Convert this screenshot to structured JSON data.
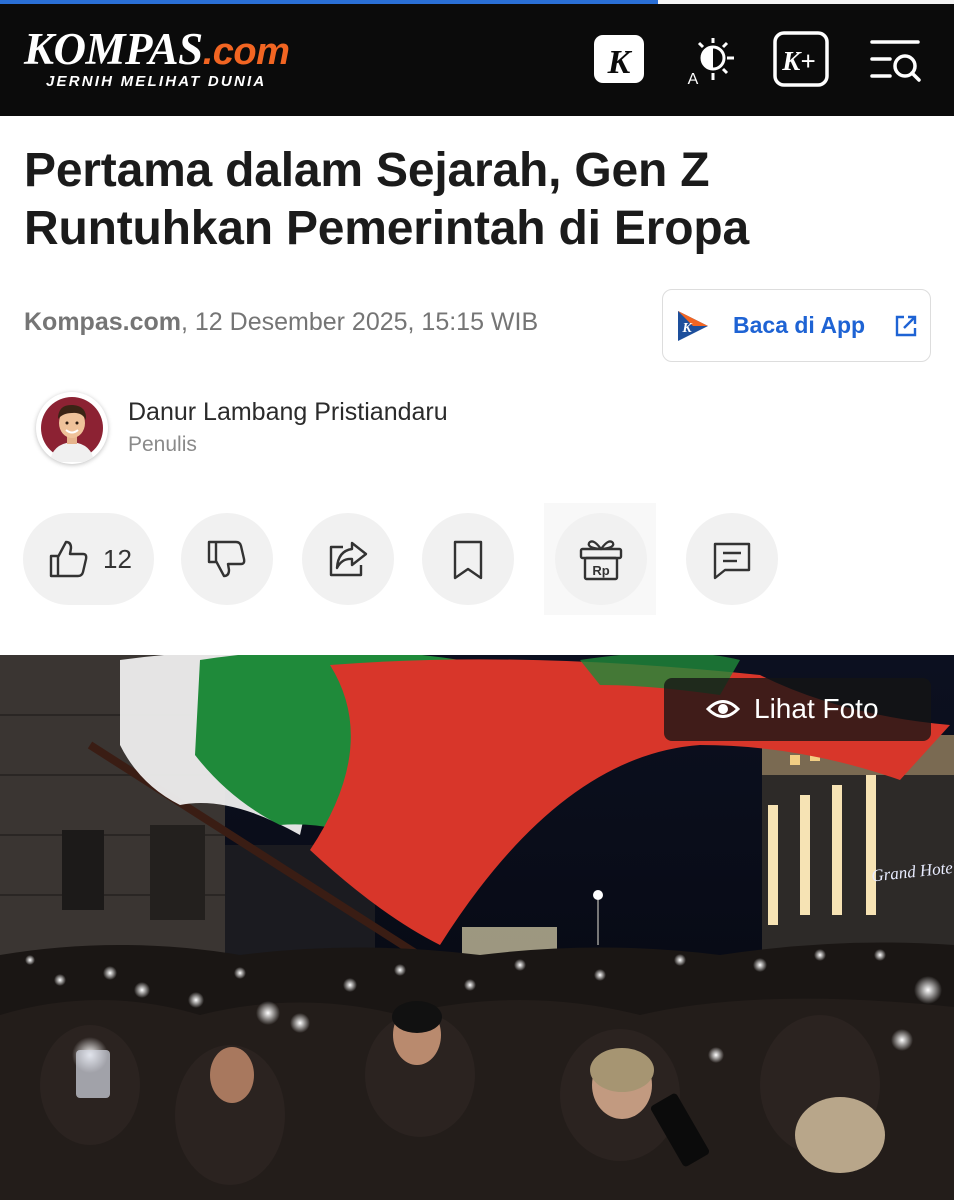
{
  "header": {
    "logo_brand": "KOMPAS",
    "logo_tld": ".com",
    "logo_tagline": "JERNIH MELIHAT DUNIA",
    "reading_progress": 0.69,
    "icons": [
      "kompas-k-icon",
      "display-mode-icon",
      "kompas-plus-icon",
      "menu-search-icon"
    ]
  },
  "article": {
    "title": "Pertama dalam Sejarah, Gen Z Runtuhkan Pemerintah di Eropa",
    "source": "Kompas.com",
    "date_sep": ", ",
    "datetime": "12 Desember 2025, 15:15 WIB",
    "app_button_label": "Baca di App"
  },
  "author": {
    "name": "Danur Lambang Pristiandaru",
    "role": "Penulis"
  },
  "actions": {
    "like_count": "12",
    "items": [
      "like",
      "dislike",
      "share",
      "bookmark",
      "gift",
      "comment"
    ]
  },
  "photo": {
    "view_label": "Lihat Foto",
    "sign_text": "Grand Hotel",
    "colors": {
      "flag_white": "#f2f2f2",
      "flag_green": "#1f8a3a",
      "flag_red": "#d8362a",
      "sky": "#0a0e1a"
    }
  },
  "colors": {
    "header_bg": "#0b0b0b",
    "brand_orange": "#f26522",
    "link_blue": "#1e63d4"
  }
}
